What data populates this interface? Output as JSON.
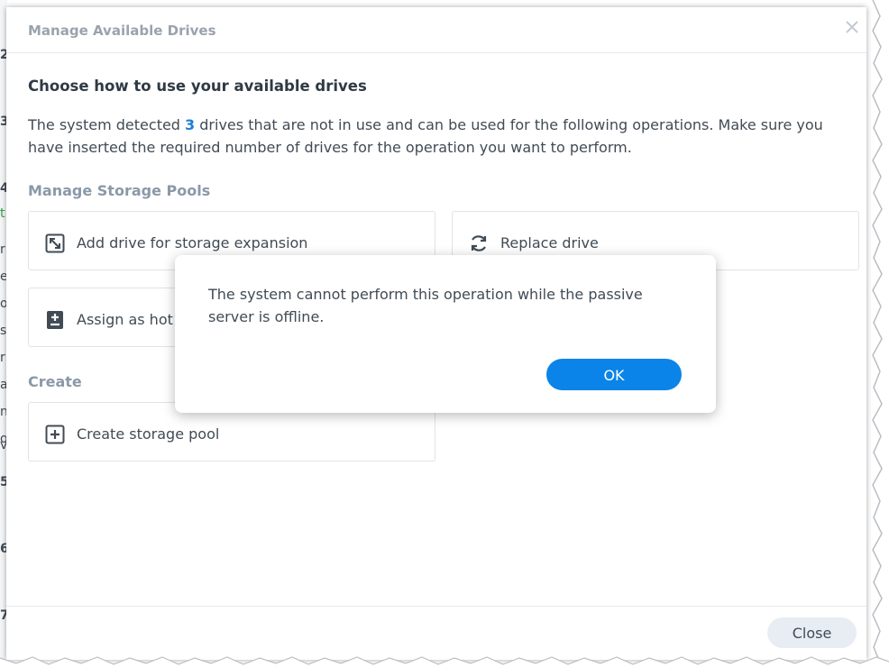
{
  "background": {
    "strip_chars": [
      {
        "text": "2",
        "style": "bold"
      },
      {
        "text": "3",
        "style": "bold"
      },
      {
        "text": "4",
        "style": "bold"
      },
      {
        "text": "t",
        "style": "green"
      },
      {
        "text": "r",
        "style": "plain"
      },
      {
        "text": "e",
        "style": "plain"
      },
      {
        "text": "o",
        "style": "plain"
      },
      {
        "text": "s",
        "style": "plain"
      },
      {
        "text": "r",
        "style": "plain"
      },
      {
        "text": "a",
        "style": "plain"
      },
      {
        "text": "n",
        "style": "plain"
      },
      {
        "text": "o",
        "style": "plain"
      },
      {
        "text": "v",
        "style": "plain"
      },
      {
        "text": "5",
        "style": "bold"
      },
      {
        "text": "6",
        "style": "bold"
      },
      {
        "text": "7",
        "style": "bold"
      }
    ]
  },
  "dialog": {
    "title": "Manage Available Drives",
    "heading": "Choose how to use your available drives",
    "description_prefix": "The system detected ",
    "drive_count": "3",
    "description_suffix": " drives that are not in use and can be used for the following operations. Make sure you have inserted the required number of drives for the operation you want to perform.",
    "sections": {
      "manage_label": "Manage Storage Pools",
      "create_label": "Create"
    },
    "cards": {
      "add_drive": "Add drive for storage expansion",
      "replace_drive": "Replace drive",
      "assign_hot_spare": "Assign as hot",
      "create_pool": "Create storage pool"
    },
    "footer": {
      "close_label": "Close"
    }
  },
  "alert": {
    "message": "The system cannot perform this operation while the passive server is offline.",
    "ok_label": "OK"
  },
  "colors": {
    "accent": "#0a84e8",
    "count_highlight": "#1e7fd6",
    "section_label": "#8a99a8"
  }
}
